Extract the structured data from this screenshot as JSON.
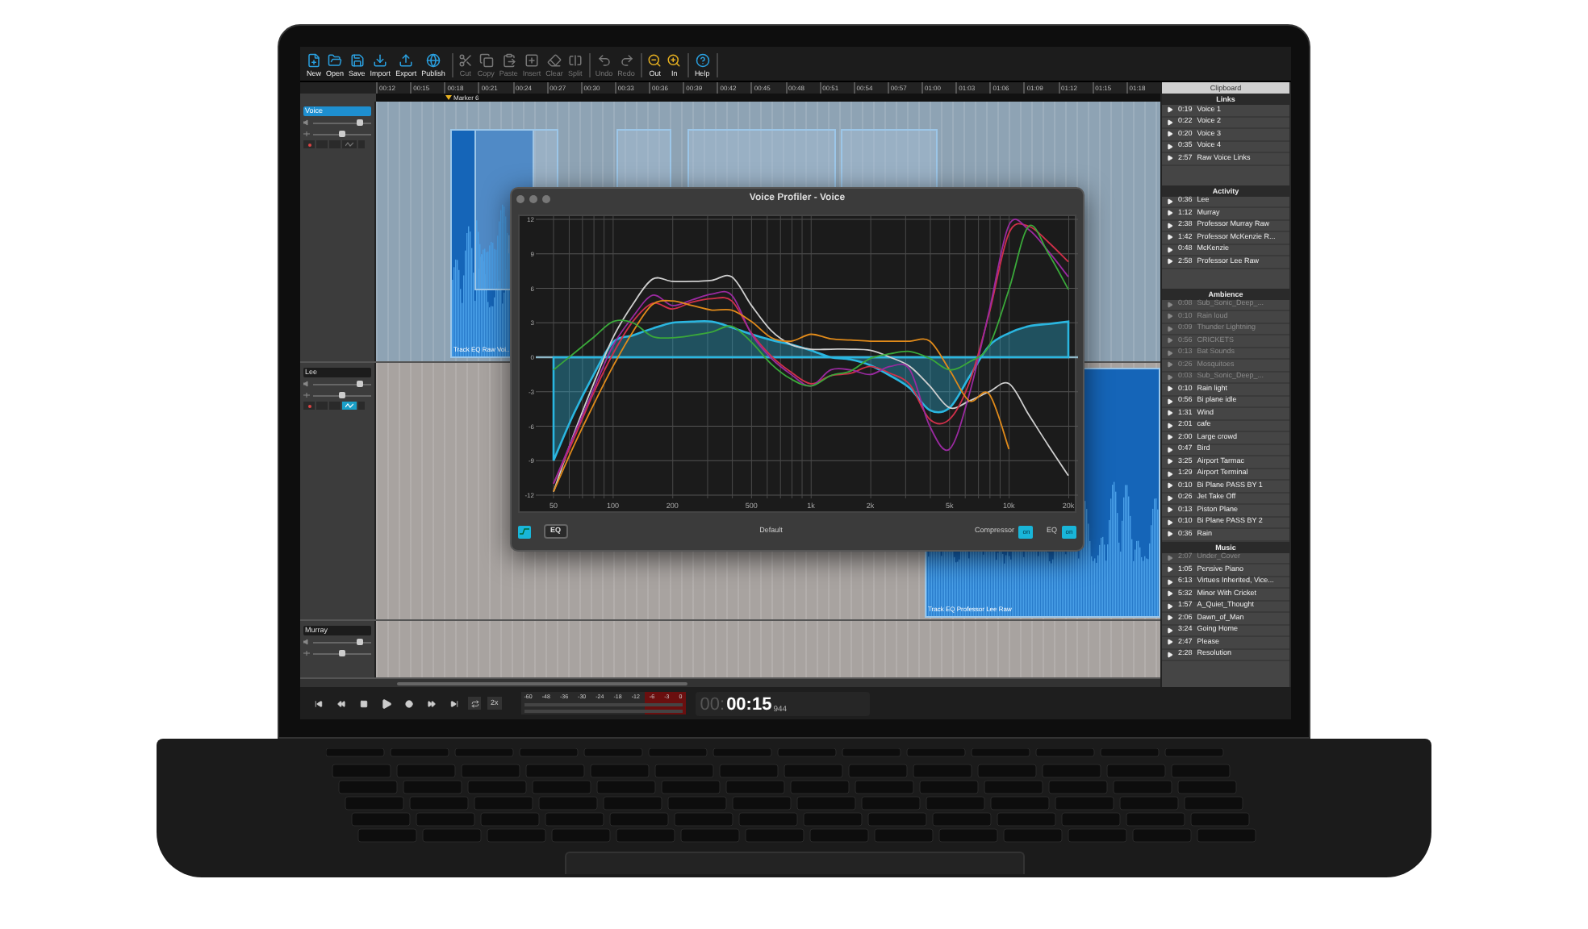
{
  "toolbar": {
    "groups": [
      [
        {
          "label": "New",
          "disabled": false
        },
        {
          "label": "Open",
          "disabled": false
        },
        {
          "label": "Save",
          "disabled": false
        },
        {
          "label": "Import",
          "disabled": false
        },
        {
          "label": "Export",
          "disabled": false
        },
        {
          "label": "Publish",
          "disabled": false
        }
      ],
      [
        {
          "label": "Cut",
          "disabled": true
        },
        {
          "label": "Copy",
          "disabled": true
        },
        {
          "label": "Paste",
          "disabled": true
        },
        {
          "label": "Insert",
          "disabled": true
        },
        {
          "label": "Clear",
          "disabled": true
        },
        {
          "label": "Split",
          "disabled": true
        }
      ],
      [
        {
          "label": "Undo",
          "disabled": true
        },
        {
          "label": "Redo",
          "disabled": true
        }
      ],
      [
        {
          "label": "Out",
          "disabled": false
        },
        {
          "label": "In",
          "disabled": false
        }
      ],
      [
        {
          "label": "Help",
          "disabled": false
        }
      ]
    ]
  },
  "ruler": {
    "ticks": [
      "00:12",
      "00:15",
      "00:18",
      "00:21",
      "00:24",
      "00:27",
      "00:30",
      "00:33",
      "00:36",
      "00:39",
      "00:42",
      "00:45",
      "00:48",
      "00:51",
      "00:54",
      "00:57",
      "01:00",
      "01:03",
      "01:06",
      "01:09",
      "01:12",
      "01:15",
      "01:18"
    ],
    "marker": "Marker 6"
  },
  "tracks": [
    {
      "name": "Voice",
      "selected": true,
      "volume": {
        "level": 0.8
      },
      "pan": {
        "level": 0.5
      },
      "fx_on": false,
      "clip_label": "Track EQ Raw Voi..."
    },
    {
      "name": "Lee",
      "selected": false,
      "volume": {
        "level": 0.8
      },
      "pan": {
        "level": 0.5
      },
      "fx_on": true,
      "clip_label": "Track EQ Professor Lee Raw"
    },
    {
      "name": "Murray",
      "selected": false,
      "volume": {
        "level": 0.8
      },
      "pan": {
        "level": 0.5
      }
    }
  ],
  "sidebar": {
    "title": "Clipboard",
    "sections": [
      {
        "title": "Links",
        "items": [
          {
            "time": "0:19",
            "name": "Voice 1",
            "dimmed": false
          },
          {
            "time": "0:22",
            "name": "Voice 2",
            "dimmed": false
          },
          {
            "time": "0:20",
            "name": "Voice 3",
            "dimmed": false
          },
          {
            "time": "0:35",
            "name": "Voice 4",
            "dimmed": false
          },
          {
            "time": "2:57",
            "name": "Raw Voice Links",
            "dimmed": false
          }
        ]
      },
      {
        "title": "Activity",
        "items": [
          {
            "time": "0:36",
            "name": "Lee",
            "dimmed": false
          },
          {
            "time": "1:12",
            "name": "Murray",
            "dimmed": false
          },
          {
            "time": "2:38",
            "name": "Professor Murray Raw",
            "dimmed": false
          },
          {
            "time": "1:42",
            "name": "Professor McKenzie R...",
            "dimmed": false
          },
          {
            "time": "0:48",
            "name": "McKenzie",
            "dimmed": false
          },
          {
            "time": "2:58",
            "name": "Professor Lee Raw",
            "dimmed": false
          }
        ]
      },
      {
        "title": "Ambience",
        "items": [
          {
            "time": "0:08",
            "name": "Sub_Sonic_Deep_...",
            "dimmed": true
          },
          {
            "time": "0:10",
            "name": "Rain loud",
            "dimmed": true
          },
          {
            "time": "0:09",
            "name": "Thunder Lightning",
            "dimmed": true
          },
          {
            "time": "0:56",
            "name": "CRICKETS",
            "dimmed": true
          },
          {
            "time": "0:13",
            "name": "Bat Sounds",
            "dimmed": true
          },
          {
            "time": "0:26",
            "name": "Mosquitoes",
            "dimmed": true
          },
          {
            "time": "0:03",
            "name": "Sub_Sonic_Deep_...",
            "dimmed": true
          },
          {
            "time": "0:10",
            "name": "Rain light",
            "dimmed": false
          },
          {
            "time": "0:56",
            "name": "Bi plane idle",
            "dimmed": false
          },
          {
            "time": "1:31",
            "name": "Wind",
            "dimmed": false
          },
          {
            "time": "2:01",
            "name": "cafe",
            "dimmed": false
          },
          {
            "time": "2:00",
            "name": "Large crowd",
            "dimmed": false
          },
          {
            "time": "0:47",
            "name": "Bird",
            "dimmed": false
          },
          {
            "time": "3:25",
            "name": "Airport Tarmac",
            "dimmed": false
          },
          {
            "time": "1:29",
            "name": "Airport Terminal",
            "dimmed": false
          },
          {
            "time": "0:10",
            "name": "Bi Plane PASS BY 1",
            "dimmed": false
          },
          {
            "time": "0:26",
            "name": "Jet Take Off",
            "dimmed": false
          },
          {
            "time": "0:13",
            "name": "Piston Plane",
            "dimmed": false
          },
          {
            "time": "0:10",
            "name": "Bi Plane PASS BY 2",
            "dimmed": false
          },
          {
            "time": "0:36",
            "name": "Rain",
            "dimmed": false
          }
        ]
      },
      {
        "title": "Music",
        "items": [
          {
            "time": "2:07",
            "name": "Under_Cover",
            "dimmed": true
          },
          {
            "time": "1:05",
            "name": "Pensive Piano",
            "dimmed": false
          },
          {
            "time": "6:13",
            "name": "Virtues Inherited, Vice...",
            "dimmed": false
          },
          {
            "time": "5:32",
            "name": "Minor With Cricket",
            "dimmed": false
          },
          {
            "time": "1:57",
            "name": "A_Quiet_Thought",
            "dimmed": false
          },
          {
            "time": "2:06",
            "name": "Dawn_of_Man",
            "dimmed": false
          },
          {
            "time": "3:24",
            "name": "Going Home",
            "dimmed": false
          },
          {
            "time": "2:47",
            "name": "Please",
            "dimmed": false
          },
          {
            "time": "2:28",
            "name": "Resolution",
            "dimmed": false
          }
        ]
      }
    ]
  },
  "transport": {
    "loop_label": "2x",
    "meter_scale": [
      "-60",
      "-48",
      "-36",
      "-30",
      "-24",
      "-18",
      "-12",
      "-6",
      "-3",
      "0"
    ],
    "time_prefix": "00:",
    "time": "00:15",
    "time_frames": "944"
  },
  "profiler": {
    "title": "Voice Profiler - Voice",
    "chart_data": {
      "type": "line",
      "categories": [
        "50",
        null,
        null,
        "100",
        null,
        null,
        "200",
        null,
        null,
        null,
        "500",
        null,
        null,
        "1k",
        null,
        null,
        "2k",
        null,
        null,
        null,
        "5k",
        null,
        null,
        "10k",
        null,
        null,
        "20k"
      ],
      "series": [
        {
          "color": "#cfcfcf",
          "values": [
            -11.7,
            -6.8,
            -2.4,
            1.7,
            4.6,
            6.8,
            6.6,
            6.6,
            6.7,
            7,
            4.5,
            2.3,
            1.1,
            0.7,
            0.7,
            0.7,
            0.6,
            0,
            -0.8,
            -2.5,
            -4.4,
            -3.8,
            -3,
            -2.3,
            -5,
            -7.7,
            -10.3
          ]
        },
        {
          "color": "#d0304a",
          "values": [
            -11,
            -7.2,
            -3.2,
            0.3,
            3.1,
            4.7,
            4.2,
            4.8,
            5.1,
            4.9,
            2.1,
            0.1,
            -1.3,
            -2.3,
            -1.6,
            -1.4,
            -0.8,
            -1.4,
            -2.4,
            -5.4,
            -5.4,
            -2.2,
            3.8,
            10.8,
            11.4,
            10,
            8.3
          ]
        },
        {
          "color": "#9a2aa0",
          "values": [
            -11,
            -6.9,
            -2.9,
            1,
            3.5,
            5.4,
            4.5,
            5,
            5.5,
            5.4,
            2,
            -0.1,
            -1.5,
            -2.5,
            -1.1,
            -1.1,
            -1.5,
            -0.8,
            -1.1,
            -6,
            -8,
            -3.2,
            4,
            11.5,
            11.1,
            9.2,
            7
          ]
        },
        {
          "color": "#e08a1a",
          "values": [
            -11.7,
            -7.8,
            -4.2,
            -0.8,
            2.2,
            4.6,
            4.9,
            4.5,
            4.1,
            4.1,
            3.1,
            1.7,
            1.4,
            2,
            1.6,
            1.5,
            1.4,
            1.4,
            1.4,
            1.4,
            -1.1,
            -3.8,
            -3.2,
            -8,
            null,
            null,
            null
          ]
        },
        {
          "color": "#3aa83a",
          "values": [
            -1.1,
            0.3,
            1.7,
            3.1,
            3,
            1.8,
            1.7,
            1.9,
            2.2,
            2.7,
            1.3,
            -0.6,
            -1.9,
            -2.5,
            -1.6,
            -1.2,
            -0.1,
            0.3,
            0.5,
            -0.1,
            -1.1,
            -0.4,
            1,
            5.9,
            11.4,
            9,
            5.9
          ]
        },
        {
          "color": "#2ab6e0",
          "type": "area",
          "values": [
            -9,
            -5,
            -1.6,
            1.3,
            1.9,
            2.5,
            3,
            3.1,
            3.1,
            2.6,
            2,
            1.5,
            1.1,
            0.6,
            0,
            -0.2,
            -0.7,
            -1.6,
            -2.7,
            -4.6,
            -4.4,
            -1.7,
            1,
            2.1,
            2.7,
            2.9,
            3.1
          ]
        }
      ],
      "ylim": [
        -12,
        12
      ],
      "yticks": [
        12,
        9,
        6,
        3,
        0,
        -3,
        -6,
        -9,
        -12
      ],
      "grid": true,
      "ref_lines": [
        {
          "axis": "y",
          "value": 0
        }
      ]
    },
    "eq_button": "EQ",
    "preset": "Default",
    "toggles": [
      {
        "label": "Compressor",
        "value": "on",
        "on": true
      },
      {
        "label": "EQ",
        "value": "on",
        "on": true
      }
    ]
  }
}
